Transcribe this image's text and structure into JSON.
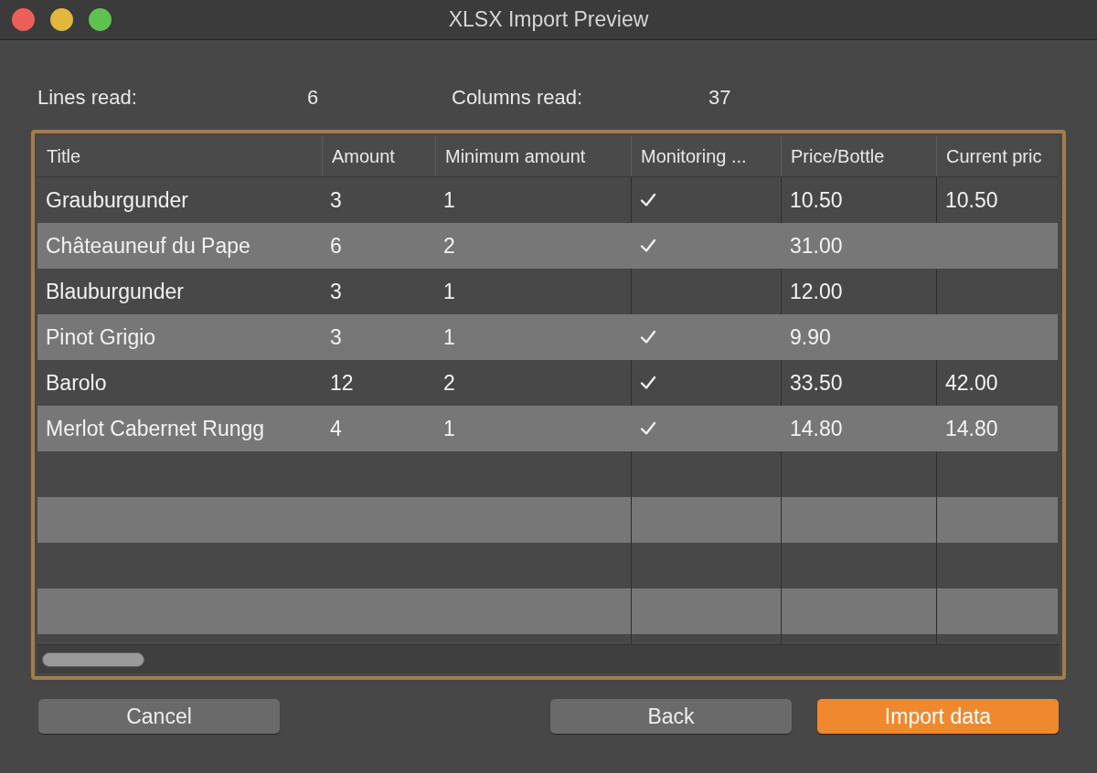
{
  "window": {
    "title": "XLSX Import Preview"
  },
  "summary": [
    {
      "label": "Lines read:",
      "value": "6"
    },
    {
      "label": "Columns read:",
      "value": "37"
    }
  ],
  "table": {
    "columns": [
      "Title",
      "Amount",
      "Minimum amount",
      "Monitoring ...",
      "Price/Bottle",
      "Current pric"
    ],
    "rows": [
      {
        "title": "Grauburgunder",
        "amount": "3",
        "minimum": "1",
        "monitoring": true,
        "price": "10.50",
        "current": "10.50"
      },
      {
        "title": "Châteauneuf du Pape",
        "amount": "6",
        "minimum": "2",
        "monitoring": true,
        "price": "31.00",
        "current": ""
      },
      {
        "title": "Blauburgunder",
        "amount": "3",
        "minimum": "1",
        "monitoring": false,
        "price": "12.00",
        "current": ""
      },
      {
        "title": "Pinot Grigio",
        "amount": "3",
        "minimum": "1",
        "monitoring": true,
        "price": "9.90",
        "current": ""
      },
      {
        "title": "Barolo",
        "amount": "12",
        "minimum": "2",
        "monitoring": true,
        "price": "33.50",
        "current": "42.00"
      },
      {
        "title": "Merlot Cabernet Rungg",
        "amount": "4",
        "minimum": "1",
        "monitoring": true,
        "price": "14.80",
        "current": "14.80"
      }
    ]
  },
  "buttons": [
    {
      "label": "Cancel",
      "kind": "secondary"
    },
    {
      "label": "Back",
      "kind": "secondary"
    },
    {
      "label": "Import data",
      "kind": "primary"
    }
  ]
}
